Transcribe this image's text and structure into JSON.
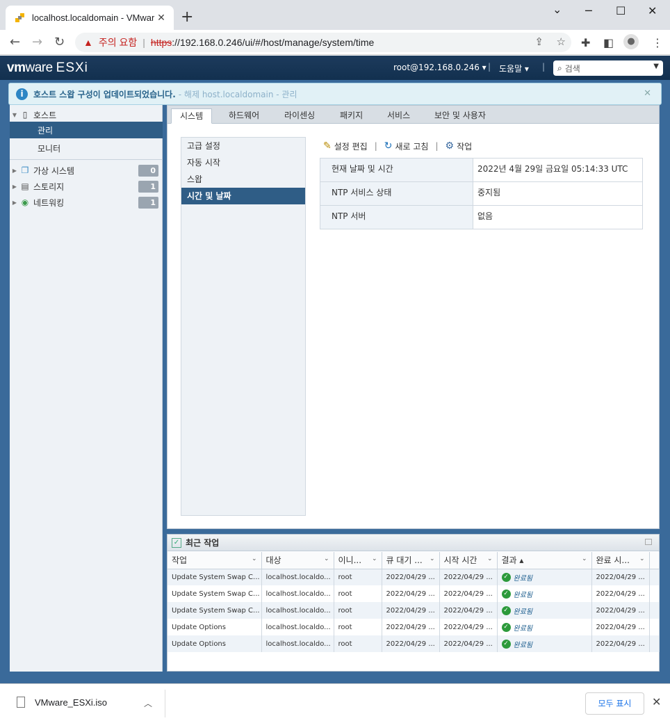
{
  "browser": {
    "tab_title": "localhost.localdomain - VMware",
    "tab_close": "✕",
    "new_tab": "+",
    "win_min": "─",
    "win_max": "☐",
    "win_close": "✕",
    "chev_down": "⌄",
    "security_warning": "주의 요함",
    "url_scheme": "https",
    "url_rest": "://192.168.0.246/ui/#/host/manage/system/time"
  },
  "header": {
    "logo_vm": "vm",
    "logo_ware": "ware",
    "logo_esxi": "ESXi",
    "user": "root@192.168.0.246 ▾",
    "help": "도움말 ▾",
    "search_placeholder": "검색"
  },
  "notice": {
    "message": "호스트 스왑 구성이 업데이트되었습니다.",
    "ghost": "- 해제 host.localdomain - 관리"
  },
  "sidebar": {
    "host": "호스트",
    "manage": "관리",
    "monitor": "모니터",
    "items": [
      {
        "label": "가상 시스템",
        "count": "0"
      },
      {
        "label": "스토리지",
        "count": "1"
      },
      {
        "label": "네트워킹",
        "count": "1"
      }
    ]
  },
  "tabs": [
    "시스템",
    "하드웨어",
    "라이센싱",
    "패키지",
    "서비스",
    "보안 및 사용자"
  ],
  "subnav": [
    "고급 설정",
    "자동 시작",
    "스왑",
    "시간 및 날짜"
  ],
  "actions": {
    "edit": "설정 편집",
    "refresh": "새로 고침",
    "task": "작업"
  },
  "info": [
    {
      "key": "현재 날짜 및 시간",
      "value": "2022년 4월 29일 금요일 05:14:33 UTC"
    },
    {
      "key": "NTP 서비스 상태",
      "value": "중지됨"
    },
    {
      "key": "NTP 서버",
      "value": "없음"
    }
  ],
  "recent": {
    "title": "최근 작업",
    "columns": [
      "작업",
      "대상",
      "이니...",
      "큐 대기 ...",
      "시작 시간",
      "결과 ▴",
      "완료 시..."
    ],
    "rows": [
      [
        "Update System Swap C...",
        "localhost.localdo...",
        "root",
        "2022/04/29 ...",
        "2022/04/29 ...",
        "완료됨",
        "2022/04/29 ..."
      ],
      [
        "Update System Swap C...",
        "localhost.localdo...",
        "root",
        "2022/04/29 ...",
        "2022/04/29 ...",
        "완료됨",
        "2022/04/29 ..."
      ],
      [
        "Update System Swap C...",
        "localhost.localdo...",
        "root",
        "2022/04/29 ...",
        "2022/04/29 ...",
        "완료됨",
        "2022/04/29 ..."
      ],
      [
        "Update Options",
        "localhost.localdo...",
        "root",
        "2022/04/29 ...",
        "2022/04/29 ...",
        "완료됨",
        "2022/04/29 ..."
      ],
      [
        "Update Options",
        "localhost.localdo...",
        "root",
        "2022/04/29 ...",
        "2022/04/29 ...",
        "완료됨",
        "2022/04/29 ..."
      ]
    ]
  },
  "downloads": {
    "file": "VMware_ESXi.iso",
    "show_all": "모두 표시"
  },
  "colors": {
    "header_bg": "#1d3b5c",
    "selection": "#2f5d86",
    "app_bg": "#3a6a9a",
    "ok_green": "#2c9a3b"
  }
}
